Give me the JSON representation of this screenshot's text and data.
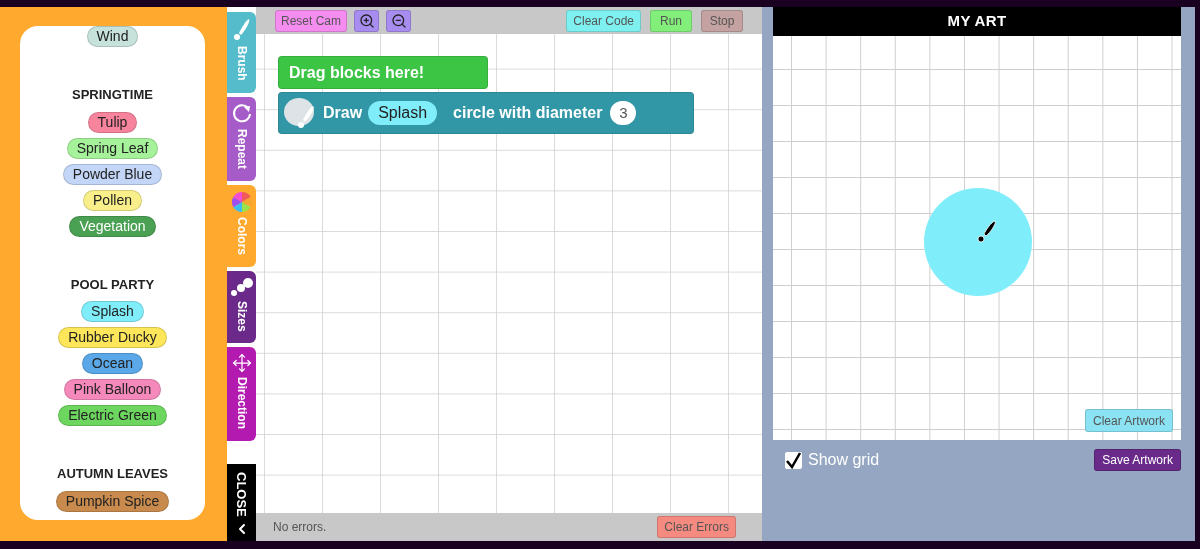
{
  "palette": {
    "groups": [
      {
        "colors": [
          {
            "label": "Wind",
            "color": "#c6e2da"
          }
        ]
      },
      {
        "title": "SPRINGTIME",
        "colors": [
          {
            "label": "Tulip",
            "color": "#f7849c"
          },
          {
            "label": "Spring Leaf",
            "color": "#a6f29a"
          },
          {
            "label": "Powder Blue",
            "color": "#c3d6f7"
          },
          {
            "label": "Pollen",
            "color": "#f8ef8a"
          },
          {
            "label": "Vegetation",
            "color": "#4ba153"
          }
        ]
      },
      {
        "title": "POOL PARTY",
        "colors": [
          {
            "label": "Splash",
            "color": "#80eefa"
          },
          {
            "label": "Rubber Ducky",
            "color": "#fde65a"
          },
          {
            "label": "Ocean",
            "color": "#5aa8e8"
          },
          {
            "label": "Pink Balloon",
            "color": "#f689bc"
          },
          {
            "label": "Electric Green",
            "color": "#6dd65e"
          }
        ]
      },
      {
        "title": "AUTUMN LEAVES",
        "colors": [
          {
            "label": "Pumpkin Spice",
            "color": "#c98b4d"
          }
        ]
      }
    ]
  },
  "category_tabs": [
    {
      "label": "Brush",
      "kind": "brush",
      "color": "#55bccc",
      "selected": false
    },
    {
      "label": "Repeat",
      "kind": "repeat",
      "color": "#a65cc8",
      "selected": false
    },
    {
      "label": "Colors",
      "kind": "colors",
      "color": "#ffaa2e",
      "selected": true
    },
    {
      "label": "Sizes",
      "kind": "sizes",
      "color": "#6b2a8a",
      "selected": false
    },
    {
      "label": "Direction",
      "kind": "direction",
      "color": "#b31bb0",
      "selected": false
    }
  ],
  "close_tab": {
    "label": "CLOSE"
  },
  "toolbar": {
    "reset_label": "Reset Cam",
    "right_buttons": [
      {
        "label": "Clear Code",
        "color": "#7ff0f0"
      },
      {
        "label": "Run",
        "color": "#82ef7a"
      },
      {
        "label": "Stop",
        "color": "#c4a2a2"
      }
    ]
  },
  "workspace": {
    "hat_block": "Drag blocks here!",
    "draw_block": {
      "verb": "Draw",
      "chip": {
        "label": "Splash",
        "color": "#80eefa"
      },
      "text": "circle with diameter",
      "diameter": "3"
    }
  },
  "status_bar": {
    "message": "No errors.",
    "clear_label": "Clear Errors"
  },
  "art_panel": {
    "title": "MY ART",
    "clear_label": "Clear Artwork",
    "show_grid": {
      "label": "Show grid",
      "checked": true
    },
    "save_label": "Save Artwork"
  }
}
